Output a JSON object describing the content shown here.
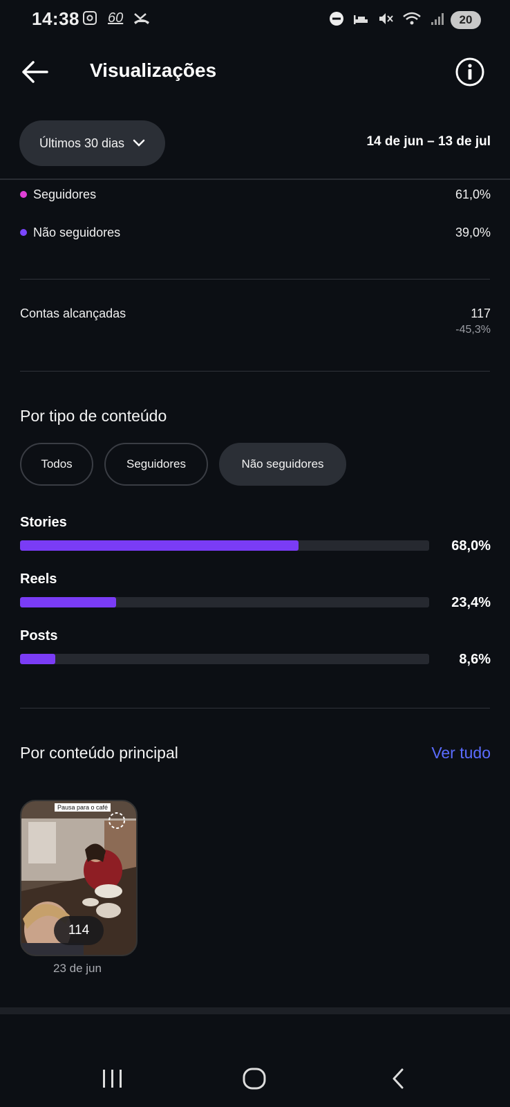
{
  "status_bar": {
    "time": "14:38",
    "left_icon_text": "60",
    "battery": "20"
  },
  "header": {
    "title": "Visualizações",
    "back_icon": "arrow-left-icon",
    "info_icon": "info-icon"
  },
  "filters": {
    "range_label": "Últimos 30 dias",
    "date_range": "14 de jun – 13 de jul"
  },
  "audience": [
    {
      "label": "Seguidores",
      "value": "61,0%",
      "color": "#e040d6"
    },
    {
      "label": "Não seguidores",
      "value": "39,0%",
      "color": "#7b46ff"
    }
  ],
  "reach": {
    "label": "Contas alcançadas",
    "value": "117",
    "change": "-45,3%"
  },
  "by_content_type": {
    "title": "Por tipo de conteúdo",
    "chips": [
      "Todos",
      "Seguidores",
      "Não seguidores"
    ],
    "selected_chip": "Não seguidores",
    "bars": [
      {
        "label": "Stories",
        "pct_text": "68,0%",
        "fraction": 0.68
      },
      {
        "label": "Reels",
        "pct_text": "23,4%",
        "fraction": 0.234
      },
      {
        "label": "Posts",
        "pct_text": "8,6%",
        "fraction": 0.086
      }
    ],
    "bar_color": "#7a3cf5"
  },
  "top_content": {
    "title": "Por conteúdo principal",
    "see_all": "Ver tudo",
    "items": [
      {
        "sticker_text": "Pausa para o café",
        "count": "114",
        "date": "23 de jun"
      }
    ]
  }
}
